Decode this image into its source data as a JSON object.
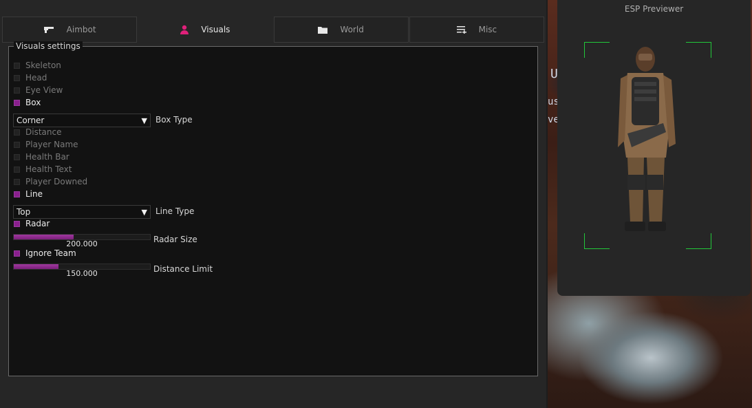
{
  "tabs": [
    {
      "label": "Aimbot",
      "icon": "gun-icon",
      "active": false
    },
    {
      "label": "Visuals",
      "icon": "user-icon",
      "active": true
    },
    {
      "label": "World",
      "icon": "folder-icon",
      "active": false
    },
    {
      "label": "Misc",
      "icon": "list-add-icon",
      "active": false
    }
  ],
  "panel": {
    "title": "Visuals settings",
    "checkboxes": {
      "skeleton": {
        "label": "Skeleton",
        "checked": false
      },
      "head": {
        "label": "Head",
        "checked": false
      },
      "eye_view": {
        "label": "Eye View",
        "checked": false
      },
      "box": {
        "label": "Box",
        "checked": true
      },
      "distance": {
        "label": "Distance",
        "checked": false
      },
      "player_name": {
        "label": "Player Name",
        "checked": false
      },
      "health_bar": {
        "label": "Health Bar",
        "checked": false
      },
      "health_text": {
        "label": "Health Text",
        "checked": false
      },
      "player_downed": {
        "label": "Player Downed",
        "checked": false
      },
      "line": {
        "label": "Line",
        "checked": true
      },
      "radar": {
        "label": "Radar",
        "checked": true
      },
      "ignore_team": {
        "label": "Ignore Team",
        "checked": true
      }
    },
    "box_type": {
      "value": "Corner",
      "label": "Box Type"
    },
    "line_type": {
      "value": "Top",
      "label": "Line Type"
    },
    "radar_size": {
      "value_text": "200.000",
      "label": "Radar Size",
      "fill_fraction": 0.44
    },
    "distance_limit": {
      "value_text": "150.000",
      "label": "Distance Limit",
      "fill_fraction": 0.33
    }
  },
  "esp": {
    "title": "ESP Previewer"
  },
  "game": {
    "text1": "U",
    "text2": "us",
    "text3": "ve"
  },
  "colors": {
    "accent": "#8a1f8e",
    "esp_box": "#22c93a",
    "active_tab_icon": "#e0207a"
  }
}
